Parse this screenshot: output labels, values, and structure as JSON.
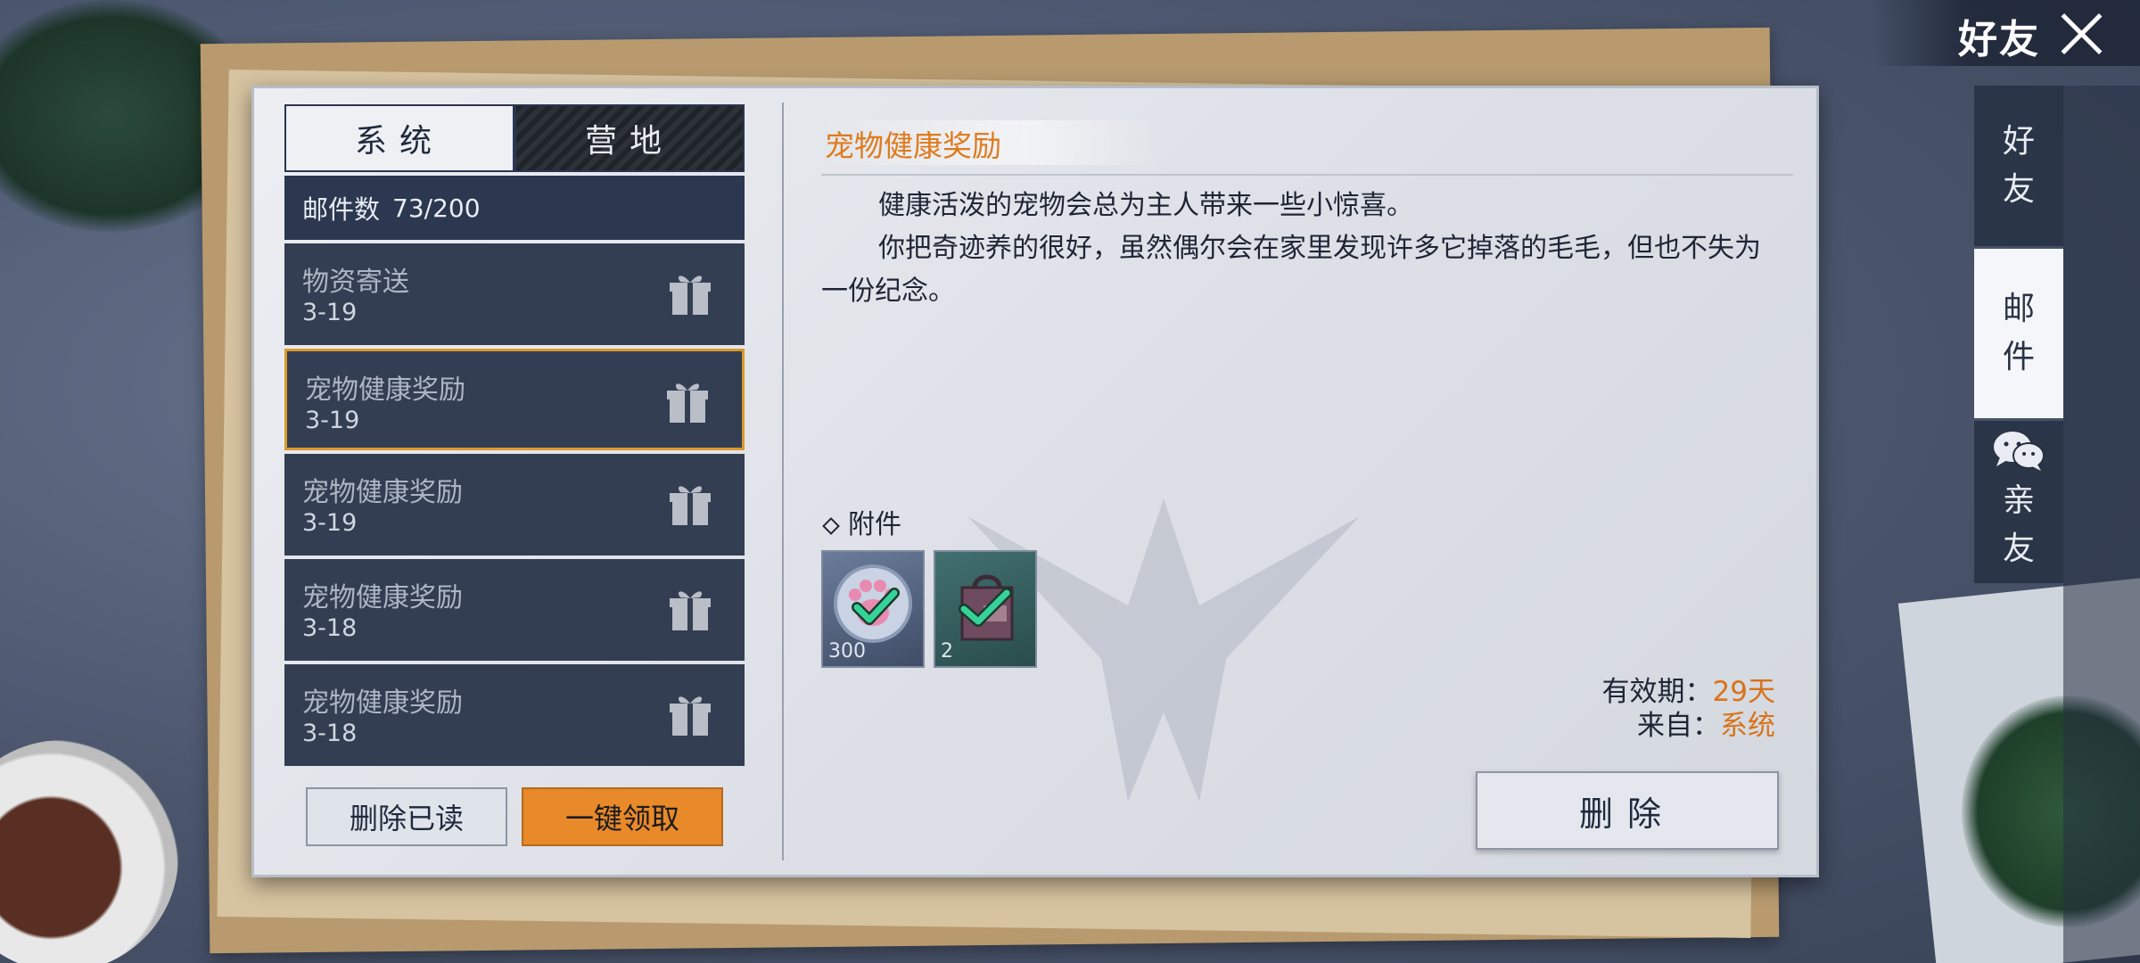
{
  "topbar": {
    "title": "好友"
  },
  "side_tabs": [
    {
      "label_1": "好",
      "label_2": "友"
    },
    {
      "label_1": "邮",
      "label_2": "件"
    },
    {
      "label_1": "亲",
      "label_2": "友"
    }
  ],
  "tabs": {
    "system": "系统",
    "camp": "营地"
  },
  "mailbox": {
    "count_label": "邮件数",
    "count_value": "73/200"
  },
  "mails": [
    {
      "title": "物资寄送",
      "date": "3-19"
    },
    {
      "title": "宠物健康奖励",
      "date": "3-19"
    },
    {
      "title": "宠物健康奖励",
      "date": "3-19"
    },
    {
      "title": "宠物健康奖励",
      "date": "3-18"
    },
    {
      "title": "宠物健康奖励",
      "date": "3-18"
    }
  ],
  "buttons": {
    "delete_read": "删除已读",
    "claim_all": "一键领取",
    "delete": "删除"
  },
  "detail": {
    "title": "宠物健康奖励",
    "paragraph_1": "健康活泼的宠物会总为主人带来一些小惊喜。",
    "paragraph_2": "你把奇迹养的很好，虽然偶尔会在家里发现许多它掉落的毛毛，但也不失为一份纪念。",
    "attachments_label": "附件",
    "attachments": [
      {
        "icon": "paw-icon",
        "quantity": "300"
      },
      {
        "icon": "bag-icon",
        "quantity": "2"
      }
    ],
    "validity_label": "有效期：",
    "validity_value": "29天",
    "from_label": "来自：",
    "from_value": "系统"
  },
  "colors": {
    "accent_orange": "#e8892a",
    "title_orange": "#e07b1c",
    "list_bg": "#333e52",
    "selected_border": "#d99a2b"
  }
}
